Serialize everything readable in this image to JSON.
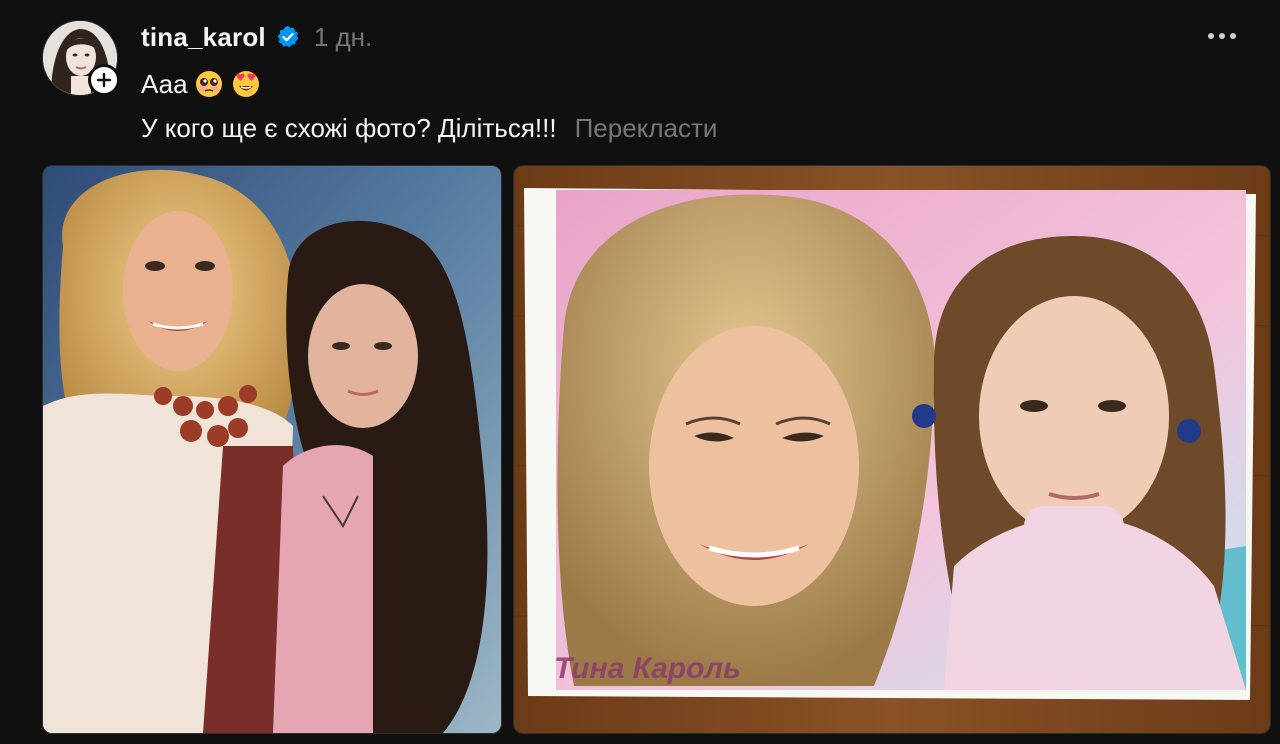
{
  "post": {
    "username": "tina_karol",
    "timestamp": "1 дн.",
    "text_line1": "Ааа",
    "emoji": [
      "pleading-face-emoji",
      "heart-eyes-emoji"
    ],
    "text_line2": "У кого ще є схожі фото? Діліться!!!",
    "translate_label": "Перекласти",
    "photos": [
      {
        "alt": "photo-woman-and-girl-1"
      },
      {
        "alt": "photo-woman-and-girl-2",
        "caption": "Тина Кароль"
      }
    ]
  },
  "colors": {
    "background": "#101010",
    "text_primary": "#f3f5f7",
    "text_secondary": "#777777",
    "verified_blue": "#0095f6"
  }
}
